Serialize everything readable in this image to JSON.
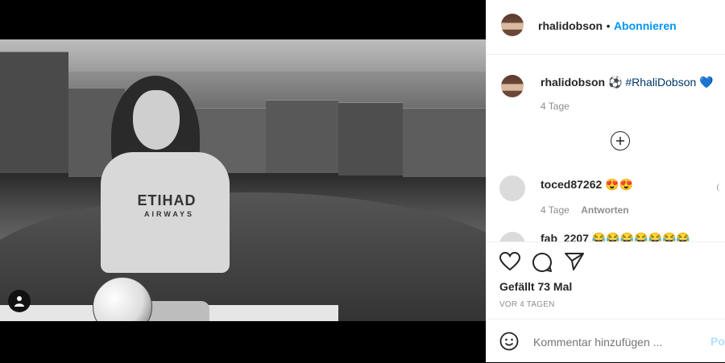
{
  "post": {
    "username": "rhalidobson",
    "follow_label": "Abonnieren",
    "separator": "•",
    "caption_emoji": "⚽",
    "caption_hashtag": "#RhaliDobson",
    "caption_heart": "💙",
    "caption_time": "4 Tage",
    "load_more_icon": "plus-circle"
  },
  "comments": [
    {
      "username": "toced87262",
      "text": "😍😍",
      "time": "4 Tage",
      "reply_label": "Antworten"
    },
    {
      "username": "fab_2207",
      "text": "😂😂😂😂😂😂😂"
    }
  ],
  "actions": {
    "likes_text": "Gefällt 73 Mal",
    "date_text": "VOR 4 TAGEN",
    "icons": [
      "heart-icon",
      "comment-icon",
      "share-icon"
    ]
  },
  "add_comment": {
    "placeholder": "Kommentar hinzufügen ...",
    "post_label": "Posten"
  },
  "photo": {
    "jersey_text": "ETIHAD",
    "jersey_subtext": "AIRWAYS"
  },
  "colors": {
    "link": "#0095f6",
    "hashtag": "#00376b",
    "text": "#262626",
    "muted": "#8e8e8e"
  }
}
